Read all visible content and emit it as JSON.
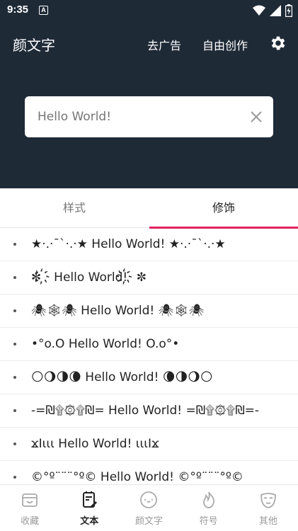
{
  "status": {
    "time": "9:35",
    "notif_glyph": "A"
  },
  "header": {
    "title": "颜文字",
    "remove_ads": "去广告",
    "free_create": "自由创作",
    "settings_icon": "gear-icon"
  },
  "search": {
    "value": "",
    "placeholder": "Hello World!"
  },
  "tabs": [
    {
      "label": "样式",
      "active": false
    },
    {
      "label": "修饰",
      "active": true
    }
  ],
  "list": [
    "★·.·¯`·.·★ Hello World! ★·.·¯`·.·★",
    "✼ ҉ Hello World!҉  ✼",
    "🕷🕸🕷 Hello World! 🕷🕸🕷",
    "•°o.O Hello World! O.o°•",
    "🌕🌖🌗🌘 Hello World! 🌘🌗🌖🌕",
    "-=₪۩۞۩₪= Hello World! =₪۩۞۩₪=-",
    "ϫΙιιι Hello World! ιιιΙϫ",
    "©°º¨¨¨°º© Hello World! ©°º¨¨¨°º©"
  ],
  "bottom_nav": [
    {
      "label": "收藏",
      "icon": "wallet-icon",
      "active": false
    },
    {
      "label": "文本",
      "icon": "document-edit-icon",
      "active": true
    },
    {
      "label": "颜文字",
      "icon": "face-icon",
      "active": false
    },
    {
      "label": "符号",
      "icon": "fire-icon",
      "active": false
    },
    {
      "label": "其他",
      "icon": "mask-icon",
      "active": false
    }
  ],
  "colors": {
    "header_bg": "#1f2a37",
    "accent": "#e0245e"
  }
}
